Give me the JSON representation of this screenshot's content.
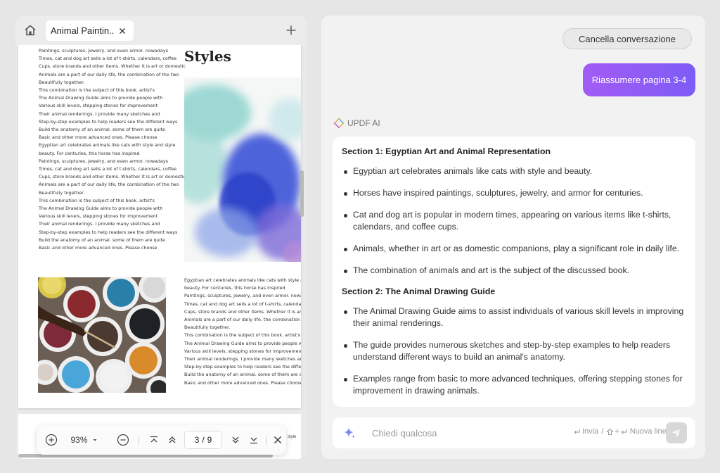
{
  "left": {
    "tab": {
      "title": "Animal Paintin..."
    },
    "page": {
      "heading": "Styles",
      "left_column": [
        "Paintings, sculptures, jewelry, and even armor. nowadays",
        "Times, cat and dog art sells a lot of t-shirts, calendars, coffee",
        "Cups, store brands and other items. Whether it is art or domestic",
        "Animals are a part of our daily life, the combination of the two",
        "Beautifully together.",
        "This combination is the subject of this book. artist's",
        "The Animal Drawing Guide aims to provide people with",
        "Various skill levels, stepping stones for improvement",
        "Their animal renderings. I provide many sketches and",
        "Step-by-step examples to help readers see the different ways",
        "Build the anatomy of an animal. some of them are quite",
        "Basic and other more advanced ones. Please choose",
        "Egyptian art celebrates animals like cats with style and style",
        "beauty. For centuries, this horse has inspired",
        "Paintings, sculptures, jewelry, and even armor. nowadays",
        "Times, cat and dog art sells a lot of t-shirts, calendars, coffee",
        "Cups, store brands and other items. Whether it is art or domestic",
        "Animals are a part of our daily life, the combination of the two",
        "Beautifully together.",
        "This combination is the subject of this book. artist's",
        "The Animal Drawing Guide aims to provide people with",
        "Various skill levels, stepping stones for improvement",
        "Their animal renderings. I provide many sketches and",
        "Step-by-step examples to help readers see the different ways",
        "Build the anatomy of an animal. some of them are quite",
        "Basic and other more advanced ones. Please choose"
      ],
      "right_column": [
        "Egyptian art celebrates animals like cats with style and style",
        "beauty. For centuries, this horse has inspired",
        "Paintings, sculptures, jewelry, and even armor. nowadays",
        "Times, cat and dog art sells a lot of t-shirts, calendars, coffee",
        "Cups, store brands and other items. Whether it is art or domestic",
        "Animals are a part of our daily life, the combination of the two",
        "Beautifully together.",
        "This combination is the subject of this book. artist's",
        "The Animal Drawing Guide aims to provide people with",
        "Various skill levels, stepping stones for improvement",
        "Their animal renderings. I provide many sketches and",
        "Step-by-step examples to help readers see the different ways",
        "Build the anatomy of an animal. some of them are quite",
        "Basic and other more advanced ones. Please choose"
      ],
      "next_page_snippet": "d style"
    },
    "toolbar": {
      "zoom": "93%",
      "current_page": "3",
      "separator": "/",
      "total_pages": "9"
    }
  },
  "right": {
    "clear_button": "Cancella conversazione",
    "user_message": "Riassumere pagina 3-4",
    "ai_name": "UPDF AI",
    "sections": [
      {
        "title": "Section 1: Egyptian Art and Animal Representation",
        "bullets": [
          "Egyptian art celebrates animals like cats with style and beauty.",
          "Horses have inspired paintings, sculptures, jewelry, and armor for centuries.",
          "Cat and dog art is popular in modern times, appearing on various items like t-shirts, calendars, and coffee cups.",
          "Animals, whether in art or as domestic companions, play a significant role in daily life.",
          "The combination of animals and art is the subject of the discussed book."
        ]
      },
      {
        "title": "Section 2: The Animal Drawing Guide",
        "bullets": [
          "The Animal Drawing Guide aims to assist individuals of various skill levels in improving their animal renderings.",
          "The guide provides numerous sketches and step-by-step examples to help readers understand different ways to build an animal's anatomy.",
          "Examples range from basic to more advanced techniques, offering stepping stones for improvement in drawing animals."
        ]
      }
    ],
    "input": {
      "placeholder": "Chiedi qualcosa",
      "send_hint": "Invia",
      "hint_sep": "/",
      "newline_hint": "Nuova linea"
    }
  },
  "colors": {
    "accent_gradient_start": "#a25bf5",
    "accent_gradient_end": "#7d5cf5",
    "panel_bg": "#f2f2f2"
  }
}
